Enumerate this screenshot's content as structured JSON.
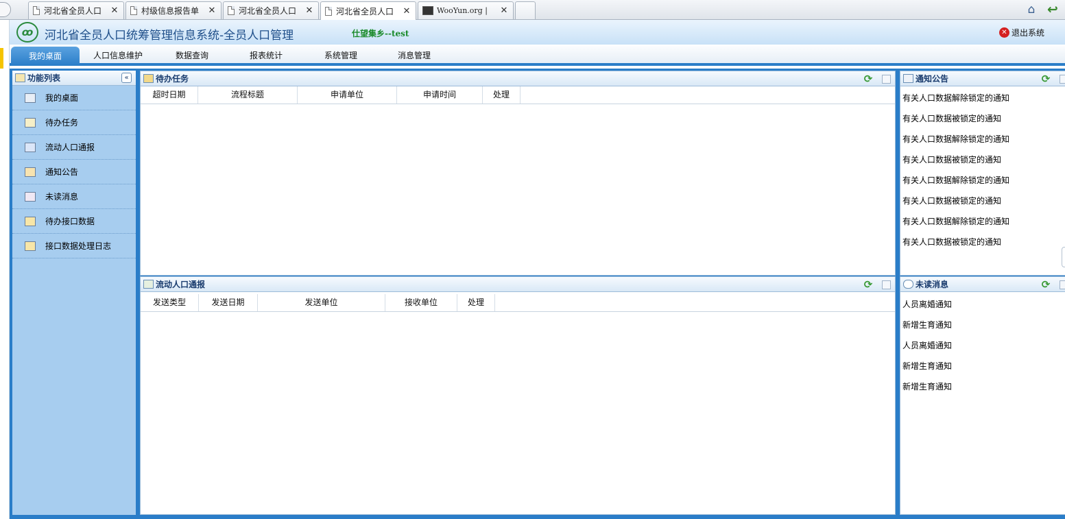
{
  "browser": {
    "tabs": [
      {
        "title": "河北省全员人口",
        "icon": "document-icon"
      },
      {
        "title": "村级信息报告单",
        "icon": "document-icon"
      },
      {
        "title": "河北省全员人口",
        "icon": "document-icon"
      },
      {
        "title": "河北省全员人口",
        "icon": "document-icon"
      },
      {
        "title": "WooYun.org | ",
        "icon": "wooyun-icon"
      },
      {
        "title": "",
        "icon": ""
      }
    ],
    "close_glyph": "✕"
  },
  "header": {
    "title": "河北省全员人口统筹管理信息系统-全员人口管理",
    "user": "仕望集乡--test",
    "logout": "退出系统"
  },
  "nav": [
    "我的桌面",
    "人口信息维护",
    "数据查询",
    "报表统计",
    "系统管理",
    "消息管理"
  ],
  "sidebar": {
    "title": "功能列表",
    "collapse_glyph": "«",
    "items": [
      "我的桌面",
      "待办任务",
      "流动人口通报",
      "通知公告",
      "未读消息",
      "待办接口数据",
      "接口数据处理日志"
    ]
  },
  "tasks": {
    "title": "待办任务",
    "columns": [
      "超时日期",
      "流程标题",
      "申请单位",
      "申请时间",
      "处理"
    ]
  },
  "floating": {
    "title": "流动人口通报",
    "columns": [
      "发送类型",
      "发送日期",
      "发送单位",
      "接收单位",
      "处理"
    ]
  },
  "notices": {
    "title": "通知公告",
    "items": [
      "有关人口数据解除锁定的通知",
      "有关人口数据被锁定的通知",
      "有关人口数据解除锁定的通知",
      "有关人口数据被锁定的通知",
      "有关人口数据解除锁定的通知",
      "有关人口数据被锁定的通知",
      "有关人口数据解除锁定的通知",
      "有关人口数据被锁定的通知"
    ]
  },
  "unread": {
    "title": "未读消息",
    "items": [
      "人员离婚通知",
      "新增生育通知",
      "人员离婚通知",
      "新增生育通知",
      "新增生育通知"
    ]
  },
  "colors": {
    "accent": "#2a7dc8",
    "sidebar": "#a7cdef",
    "user": "#1a8a2a"
  }
}
